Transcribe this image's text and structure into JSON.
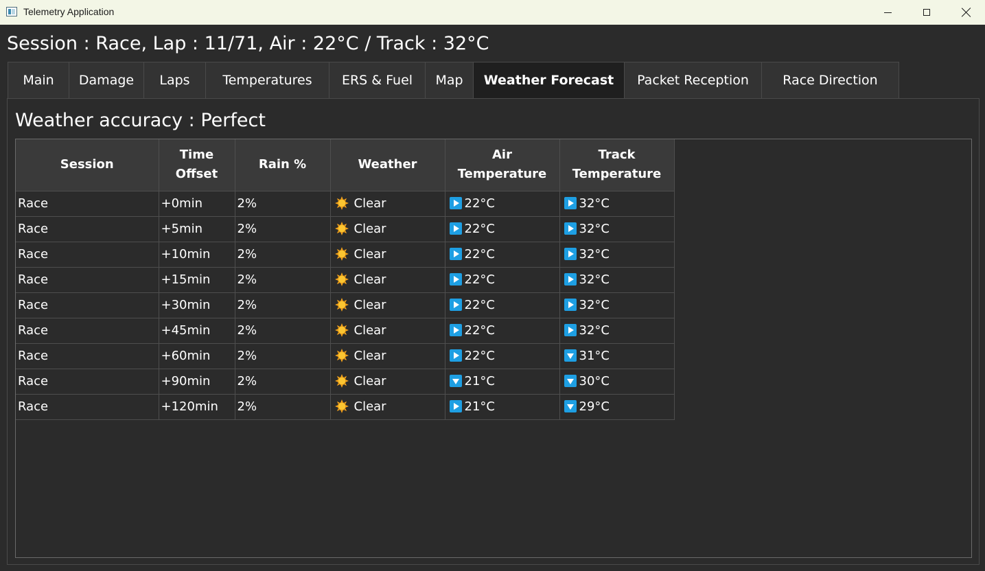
{
  "window": {
    "title": "Telemetry Application",
    "icon": "app-window-icon"
  },
  "header": {
    "session_line": "Session : Race, Lap : 11/71, Air : 22°C / Track : 32°C"
  },
  "tabs": [
    {
      "label": "Main",
      "active": false
    },
    {
      "label": "Damage",
      "active": false
    },
    {
      "label": "Laps",
      "active": false
    },
    {
      "label": "Temperatures",
      "active": false
    },
    {
      "label": "ERS & Fuel",
      "active": false
    },
    {
      "label": "Map",
      "active": false
    },
    {
      "label": "Weather Forecast",
      "active": true
    },
    {
      "label": "Packet Reception",
      "active": false
    },
    {
      "label": "Race Direction",
      "active": false
    }
  ],
  "weather": {
    "accuracy_label": "Weather accuracy : Perfect",
    "columns": {
      "session": "Session",
      "time_offset_line1": "Time",
      "time_offset_line2": "Offset",
      "rain": "Rain %",
      "weather": "Weather",
      "air_line1": "Air",
      "air_line2": "Temperature",
      "track_line1": "Track",
      "track_line2": "Temperature"
    },
    "rows": [
      {
        "session": "Race",
        "offset": "+0min",
        "rain": "2%",
        "weather": "Clear",
        "weather_icon": "sun-icon",
        "air": "22°C",
        "air_trend": "steady",
        "track": "32°C",
        "track_trend": "steady"
      },
      {
        "session": "Race",
        "offset": "+5min",
        "rain": "2%",
        "weather": "Clear",
        "weather_icon": "sun-icon",
        "air": "22°C",
        "air_trend": "steady",
        "track": "32°C",
        "track_trend": "steady"
      },
      {
        "session": "Race",
        "offset": "+10min",
        "rain": "2%",
        "weather": "Clear",
        "weather_icon": "sun-icon",
        "air": "22°C",
        "air_trend": "steady",
        "track": "32°C",
        "track_trend": "steady"
      },
      {
        "session": "Race",
        "offset": "+15min",
        "rain": "2%",
        "weather": "Clear",
        "weather_icon": "sun-icon",
        "air": "22°C",
        "air_trend": "steady",
        "track": "32°C",
        "track_trend": "steady"
      },
      {
        "session": "Race",
        "offset": "+30min",
        "rain": "2%",
        "weather": "Clear",
        "weather_icon": "sun-icon",
        "air": "22°C",
        "air_trend": "steady",
        "track": "32°C",
        "track_trend": "steady"
      },
      {
        "session": "Race",
        "offset": "+45min",
        "rain": "2%",
        "weather": "Clear",
        "weather_icon": "sun-icon",
        "air": "22°C",
        "air_trend": "steady",
        "track": "32°C",
        "track_trend": "steady"
      },
      {
        "session": "Race",
        "offset": "+60min",
        "rain": "2%",
        "weather": "Clear",
        "weather_icon": "sun-icon",
        "air": "22°C",
        "air_trend": "steady",
        "track": "31°C",
        "track_trend": "down"
      },
      {
        "session": "Race",
        "offset": "+90min",
        "rain": "2%",
        "weather": "Clear",
        "weather_icon": "sun-icon",
        "air": "21°C",
        "air_trend": "down",
        "track": "30°C",
        "track_trend": "down"
      },
      {
        "session": "Race",
        "offset": "+120min",
        "rain": "2%",
        "weather": "Clear",
        "weather_icon": "sun-icon",
        "air": "21°C",
        "air_trend": "steady",
        "track": "29°C",
        "track_trend": "down"
      }
    ]
  },
  "colors": {
    "background": "#2b2b2b",
    "header_cell": "#3a3a3a",
    "active_tab": "#1f1f1f",
    "trend_icon": "#1e9fe3",
    "sun": "#f5b51b"
  }
}
